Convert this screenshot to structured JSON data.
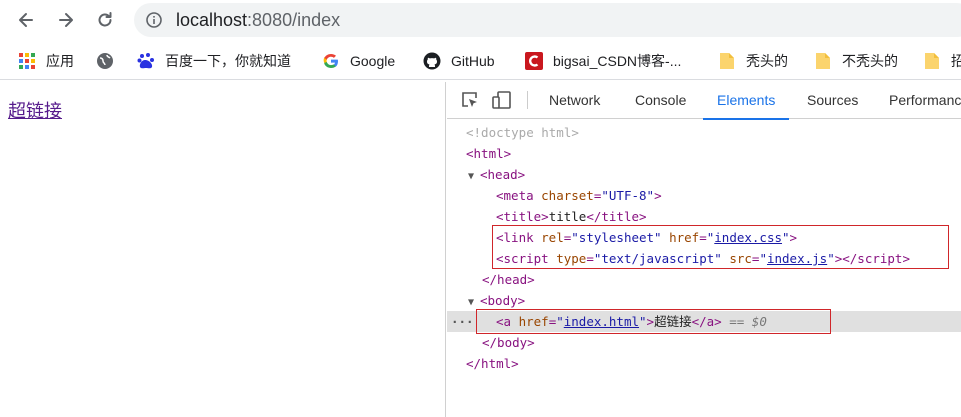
{
  "browser": {
    "url_host": "localhost",
    "url_rest": ":8080/index",
    "colors": {
      "accent": "#1a73e8",
      "highlight": "#d0262a",
      "visited_link": "#551a8b"
    }
  },
  "bookmarks": [
    {
      "label": "应用",
      "icon": "apps-grid-icon"
    },
    {
      "label": "",
      "icon": "globe-icon"
    },
    {
      "label": "百度一下，你就知道",
      "icon": "baidu-icon"
    },
    {
      "label": "Google",
      "icon": "google-icon"
    },
    {
      "label": "GitHub",
      "icon": "github-icon"
    },
    {
      "label": "bigsai_CSDN博客-...",
      "icon": "csdn-icon"
    },
    {
      "label": "秃头的",
      "icon": "folder-icon"
    },
    {
      "label": "不秃头的",
      "icon": "folder-icon"
    },
    {
      "label": "招",
      "icon": "folder-icon"
    }
  ],
  "page": {
    "link_text": "超链接"
  },
  "devtools": {
    "tabs": [
      "Network",
      "Console",
      "Elements",
      "Sources",
      "Performanc"
    ],
    "active_tab": "Elements",
    "dom": {
      "doctype": "<!doctype html>",
      "html_open": "<html>",
      "head_open": "<head>",
      "meta_attr": "charset",
      "meta_val": "\"UTF-8\"",
      "title_text": "title",
      "link_rel_attr": "rel",
      "link_rel_val": "\"stylesheet\"",
      "link_href_attr": "href",
      "link_href_val": "index.css",
      "script_type_attr": "type",
      "script_type_val": "\"text/javascript\"",
      "script_src_attr": "src",
      "script_src_val": "index.js",
      "head_close": "</head>",
      "body_open": "<body>",
      "a_href_attr": "href",
      "a_href_val": "index.html",
      "a_text": "超链接",
      "a_marker": "== $0",
      "body_close": "</body>",
      "html_close": "</html>"
    }
  }
}
